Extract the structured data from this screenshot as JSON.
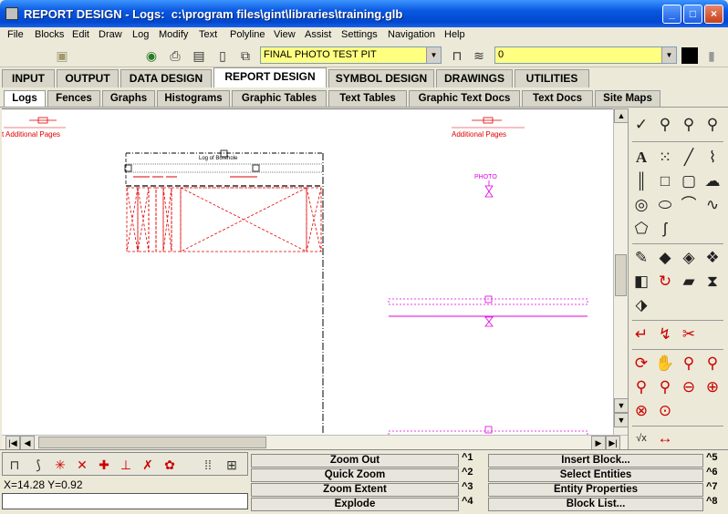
{
  "window": {
    "title": "REPORT DESIGN - Logs:  c:\\program files\\gint\\libraries\\training.glb",
    "minimize": "_",
    "maximize": "□",
    "close": "×"
  },
  "menu": [
    "File",
    "Blocks",
    "Edit",
    "Draw",
    "Log",
    "Modify",
    "Text",
    "Polyline",
    "View",
    "Assist",
    "Settings",
    "Navigation",
    "Help"
  ],
  "toolbar": {
    "report_value": "FINAL PHOTO TEST PIT",
    "layer_value": "0",
    "icons": [
      "save-disk-icon",
      "eye-icon",
      "printer-icon",
      "properties-icon",
      "new-page-icon",
      "lookup-icon",
      "lock-icon",
      "layers-icon",
      "color-swatch-icon",
      "paste-icon"
    ]
  },
  "main_tabs": [
    {
      "label": "INPUT",
      "active": false
    },
    {
      "label": "OUTPUT",
      "active": false
    },
    {
      "label": "DATA DESIGN",
      "active": false
    },
    {
      "label": "REPORT DESIGN",
      "active": true
    },
    {
      "label": "SYMBOL DESIGN",
      "active": false
    },
    {
      "label": "DRAWINGS",
      "active": false
    },
    {
      "label": "UTILITIES",
      "active": false
    }
  ],
  "sub_tabs": [
    {
      "label": "Logs",
      "active": true
    },
    {
      "label": "Fences",
      "active": false
    },
    {
      "label": "Graphs",
      "active": false
    },
    {
      "label": "Histograms",
      "active": false
    },
    {
      "label": "Graphic Tables",
      "active": false
    },
    {
      "label": "Text Tables",
      "active": false
    },
    {
      "label": "Graphic Text Docs",
      "active": false
    },
    {
      "label": "Text Docs",
      "active": false
    },
    {
      "label": "Site Maps",
      "active": false
    }
  ],
  "canvas": {
    "left_page_label": "t Additional Pages",
    "right_page_label": "Additional Pages",
    "log_title": "Log of Borehole",
    "photo_label": "PHOTO",
    "colors": {
      "red": "#e00000",
      "magenta": "#e000e0",
      "black": "#000000"
    }
  },
  "status": {
    "coords": "X=14.28   Y=0.92",
    "command_input": ""
  },
  "commands": {
    "left": [
      {
        "label": "Zoom Out",
        "key": "^1"
      },
      {
        "label": "Quick Zoom",
        "key": "^2"
      },
      {
        "label": "Zoom Extent",
        "key": "^3"
      },
      {
        "label": "Explode",
        "key": "^4"
      }
    ],
    "right": [
      {
        "label": "Insert Block...",
        "key": "^5"
      },
      {
        "label": "Select Entities",
        "key": "^6"
      },
      {
        "label": "Entity Properties",
        "key": "^7"
      },
      {
        "label": "Block List...",
        "key": "^8"
      }
    ]
  }
}
